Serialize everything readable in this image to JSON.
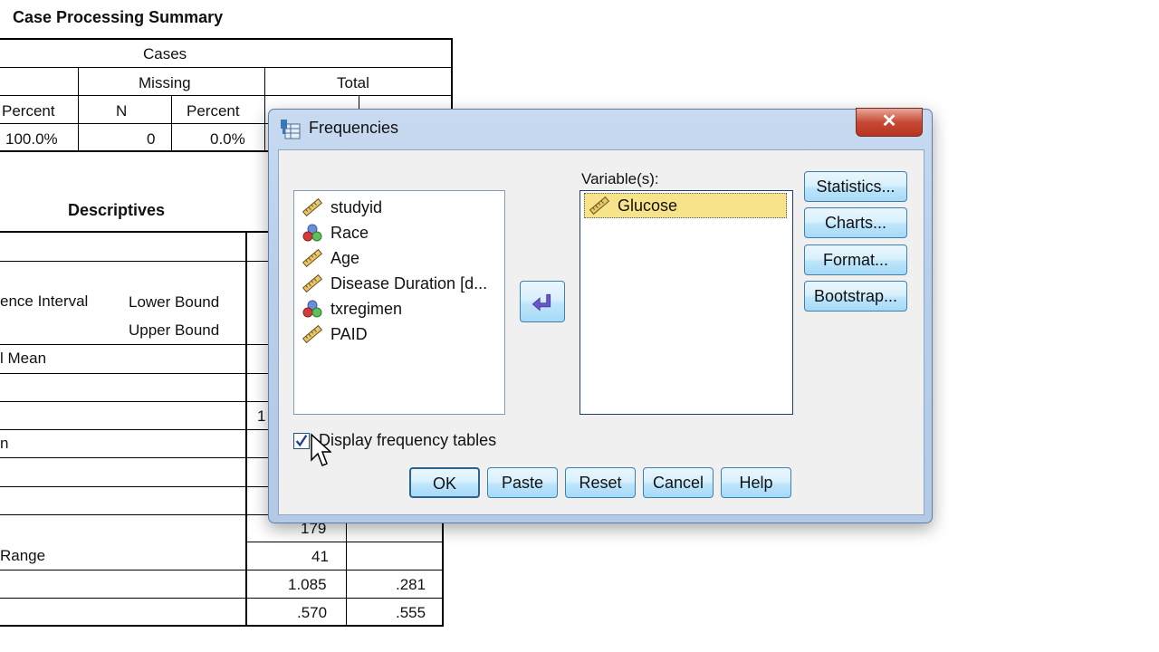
{
  "case_summary": {
    "title": "Case Processing Summary",
    "header_cases": "Cases",
    "header_missing": "Missing",
    "header_total": "Total",
    "sub_percent_valid": "Percent",
    "sub_n_missing": "N",
    "sub_percent_missing": "Percent",
    "row_valid_percent": "100.0%",
    "row_missing_n": "0",
    "row_missing_percent": "0.0%"
  },
  "descriptives": {
    "title": "Descriptives",
    "rows": [
      {
        "label": "ence Interval",
        "sub": "Lower Bound"
      },
      {
        "label": "",
        "sub": "Upper Bound"
      },
      {
        "label": "l Mean",
        "sub": ""
      },
      {
        "label": "n",
        "sub": ""
      },
      {
        "label": "Range",
        "sub": ""
      }
    ],
    "partial_1": "1",
    "stat_179": "179",
    "stat_41": "41",
    "stat_1085": "1.085",
    "se_281": ".281",
    "stat_570": ".570",
    "se_555": ".555"
  },
  "dialog": {
    "title": "Frequencies",
    "close_label": "✕",
    "source_vars": [
      {
        "name": "studyid",
        "type": "scale"
      },
      {
        "name": "Race",
        "type": "nominal"
      },
      {
        "name": "Age",
        "type": "scale"
      },
      {
        "name": "Disease Duration [d...",
        "type": "scale"
      },
      {
        "name": "txregimen",
        "type": "nominal"
      },
      {
        "name": "PAID",
        "type": "scale"
      }
    ],
    "target_label": "Variable(s):",
    "target_vars": [
      {
        "name": "Glucose",
        "type": "scale"
      }
    ],
    "side_buttons": {
      "statistics": "Statistics...",
      "charts": "Charts...",
      "format": "Format...",
      "bootstrap": "Bootstrap..."
    },
    "display_freq_label": "Display frequency tables",
    "display_freq_checked": true,
    "bottom_buttons": {
      "ok": "OK",
      "paste": "Paste",
      "reset": "Reset",
      "cancel": "Cancel",
      "help": "Help"
    }
  },
  "colors": {
    "selected_item": "#f7e38a",
    "button_border": "#3c7fb1",
    "close_red": "#c74a35"
  }
}
